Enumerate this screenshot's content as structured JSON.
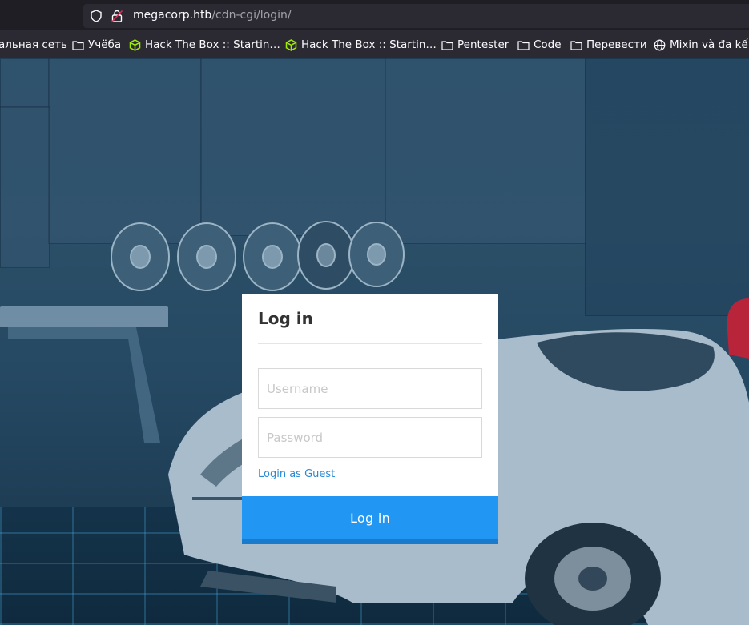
{
  "browser": {
    "url_host": "megacorp.htb",
    "url_path": "/cdn-cgi/login/",
    "bookmarks": [
      {
        "label": "альная сеть",
        "icon": "none"
      },
      {
        "label": "Учёба",
        "icon": "folder-icon"
      },
      {
        "label": "Hack The Box :: Startin…",
        "icon": "htb-cube-icon"
      },
      {
        "label": "Hack The Box :: Startin…",
        "icon": "htb-cube-icon"
      },
      {
        "label": "Pentester",
        "icon": "folder-icon"
      },
      {
        "label": "Code",
        "icon": "folder-icon"
      },
      {
        "label": "Перевести",
        "icon": "folder-icon"
      },
      {
        "label": "Mixin và đa kế t",
        "icon": "globe-icon"
      }
    ]
  },
  "login": {
    "title": "Log in",
    "username_placeholder": "Username",
    "password_placeholder": "Password",
    "guest_link": "Login as Guest",
    "submit_label": "Log in"
  },
  "colors": {
    "accent": "#2196f3",
    "link": "#2a8ad6",
    "htb_green": "#9fef00"
  }
}
